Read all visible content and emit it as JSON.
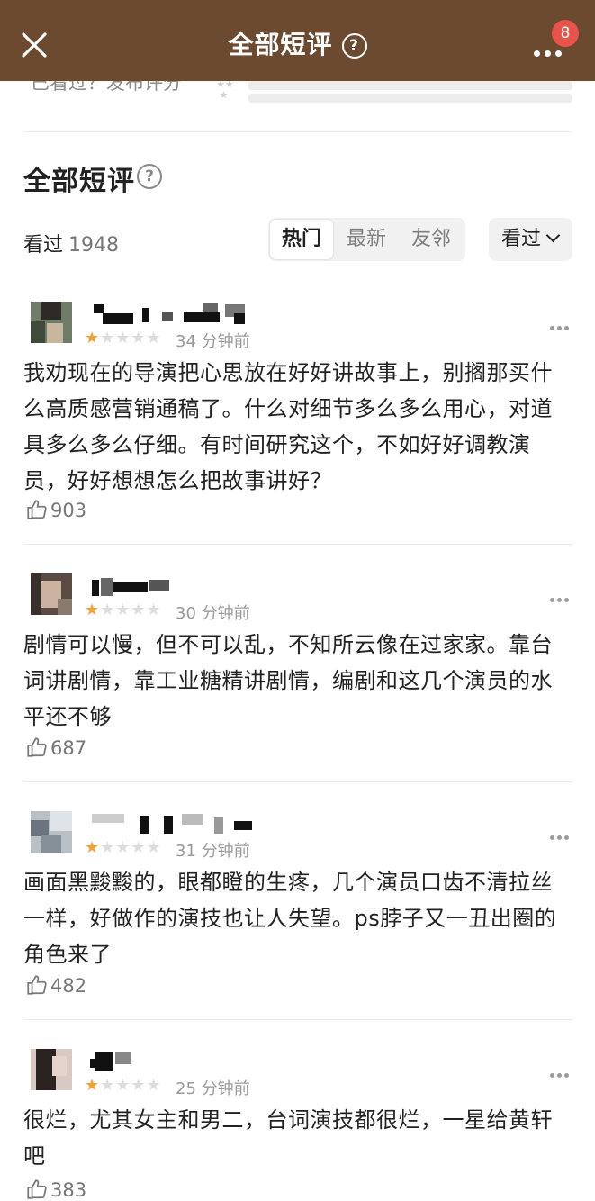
{
  "topbar": {
    "title": "全部短评",
    "help": "?",
    "badge": "8"
  },
  "rating_header": {
    "rate_link": "已看过？发布评分"
  },
  "section": {
    "title": "全部短评",
    "help": "?",
    "watched_label": "看过",
    "watched_count": "1948"
  },
  "tabs": [
    {
      "label": "热门",
      "active": true
    },
    {
      "label": "最新",
      "active": false
    },
    {
      "label": "友邻",
      "active": false
    }
  ],
  "filter": {
    "label": "看过"
  },
  "reviews": [
    {
      "stars": 1,
      "time": "34 分钟前",
      "text": "我劝现在的导演把心思放在好好讲故事上，别搁那买什么高质感营销通稿了。什么对细节多么多么用心，对道具多么多么仔细。有时间研究这个，不如好好调教演员，好好想想怎么把故事讲好？",
      "likes": "903"
    },
    {
      "stars": 1,
      "time": "30 分钟前",
      "text": "剧情可以慢，但不可以乱，不知所云像在过家家。靠台词讲剧情，靠工业糖精讲剧情，编剧和这几个演员的水平还不够",
      "likes": "687"
    },
    {
      "stars": 1,
      "time": "31 分钟前",
      "text": "画面黑黢黢的，眼都瞪的生疼，几个演员口齿不清拉丝一样，好做作的演技也让人失望。ps脖子又一丑出圈的角色来了",
      "likes": "482"
    },
    {
      "stars": 1,
      "time": "25 分钟前",
      "text": "很烂，尤其女主和男二，台词演技都很烂，一星给黄轩吧",
      "likes": "383"
    }
  ],
  "colors": {
    "topbar": "#6b4a30",
    "star_on": "#f0a232",
    "badge": "#e8544a"
  },
  "icons": [
    "close-icon",
    "help-icon",
    "more-icon",
    "chevron-down-icon",
    "thumbs-up-icon",
    "star-icon"
  ]
}
